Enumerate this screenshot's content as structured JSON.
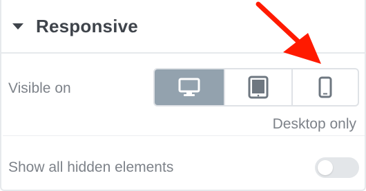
{
  "section": {
    "title": "Responsive",
    "caret_icon": "caret-down-icon"
  },
  "visible_on": {
    "label": "Visible on",
    "devices": [
      {
        "name": "Desktop",
        "icon": "desktop-icon",
        "active": true
      },
      {
        "name": "Tablet",
        "icon": "tablet-icon",
        "active": false
      },
      {
        "name": "Mobile",
        "icon": "mobile-icon",
        "active": false
      }
    ],
    "caption": "Desktop only"
  },
  "hidden_elements": {
    "label": "Show all hidden elements",
    "toggle_on": false
  },
  "colors": {
    "active_device_bg": "#93a2ae",
    "icon_color": "#6e7780",
    "arrow": "#ff1a00",
    "text_muted": "#7d8289",
    "title_text": "#3f444b"
  }
}
